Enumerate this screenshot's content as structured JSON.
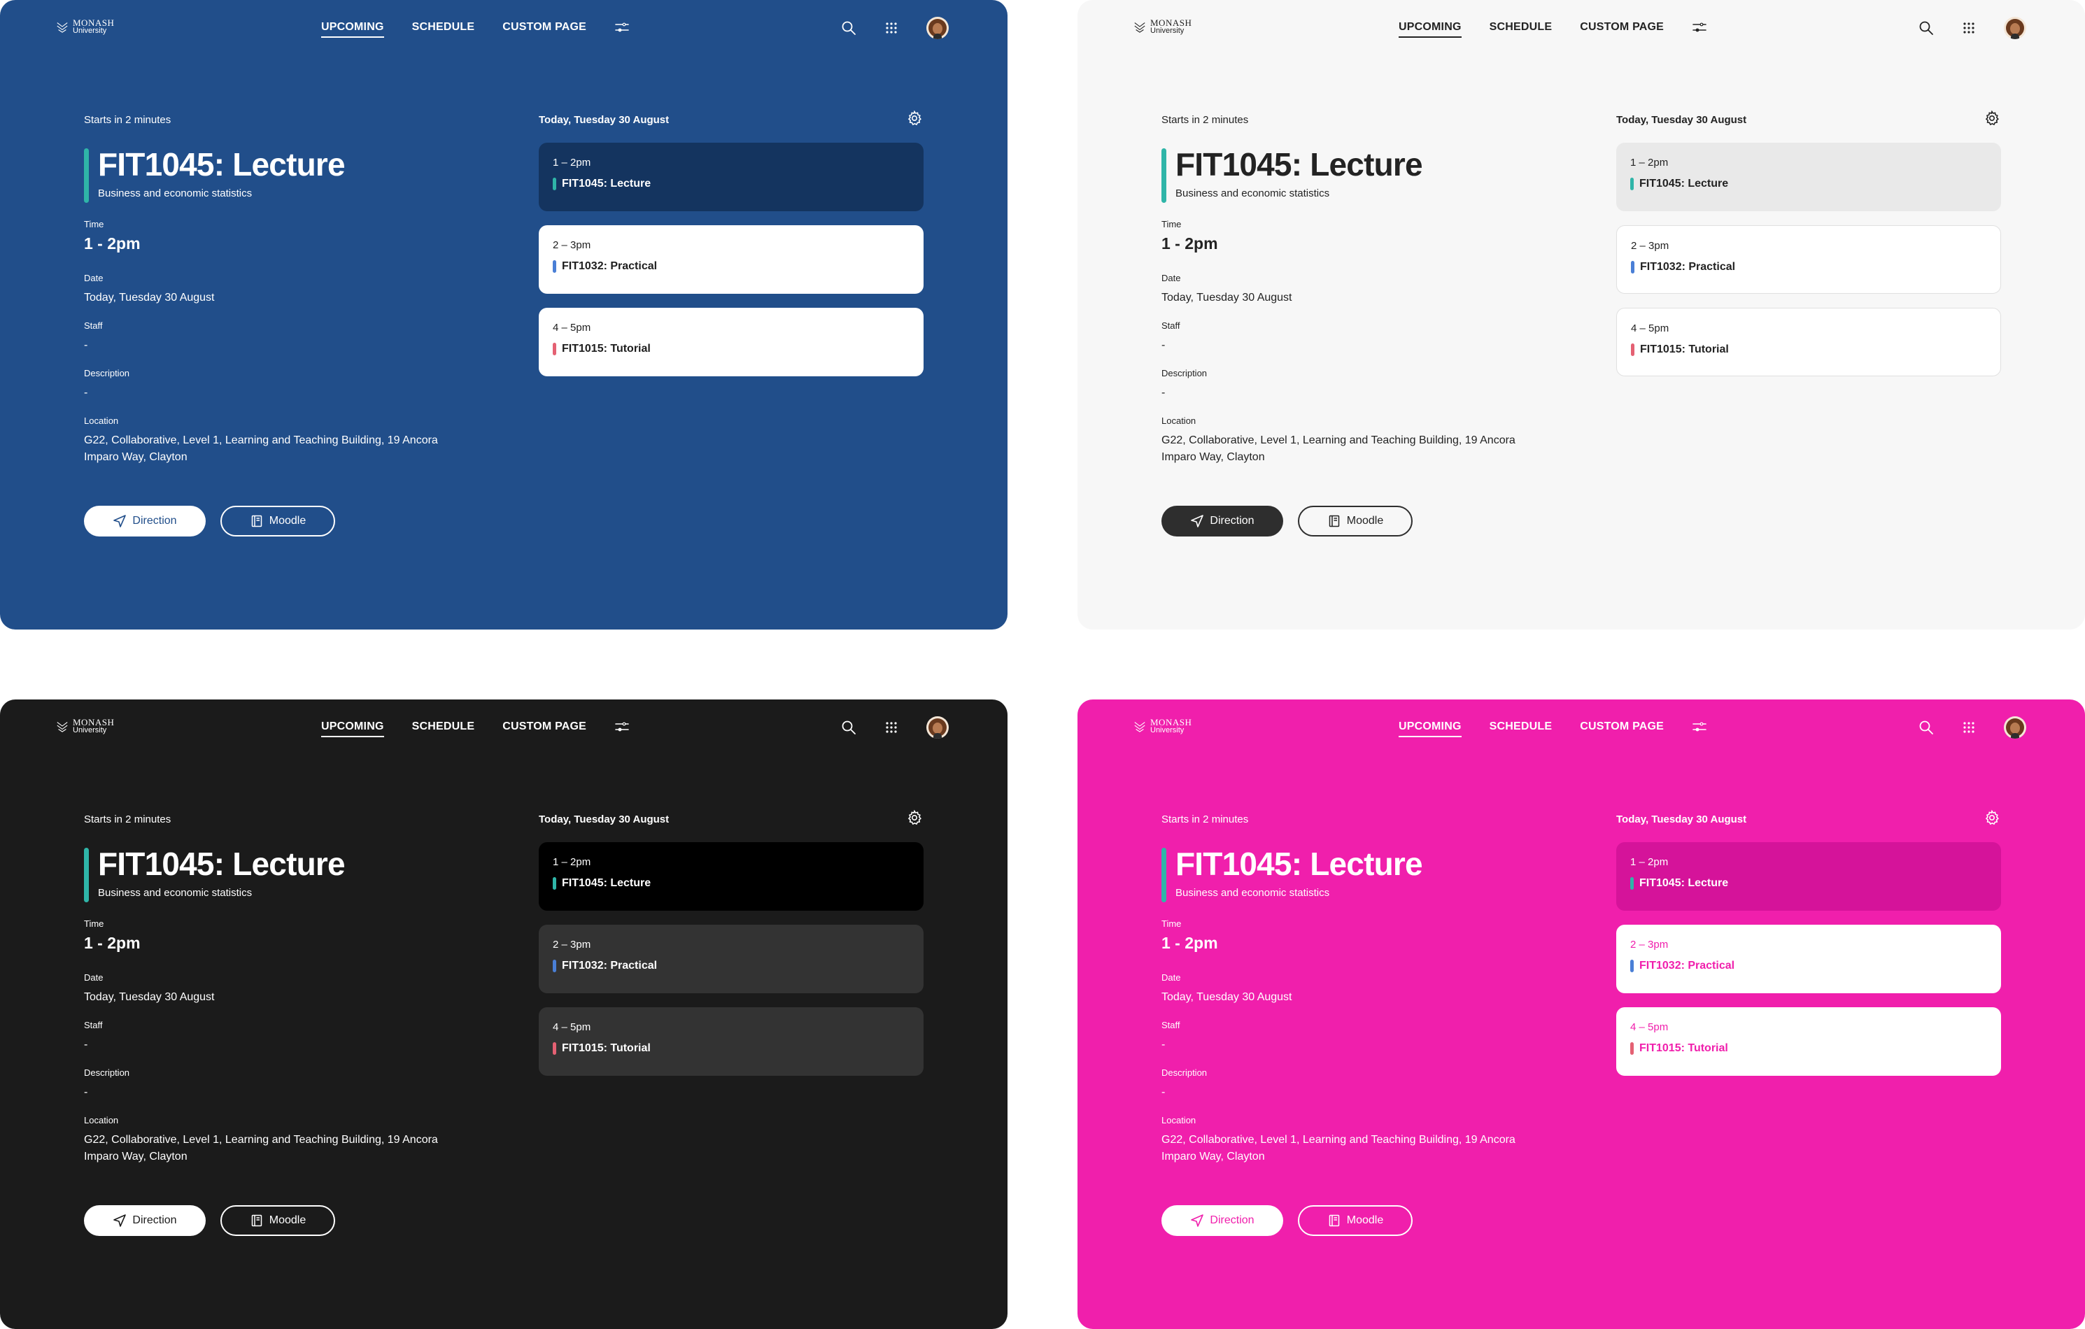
{
  "app": {
    "logo": {
      "name": "MONASH",
      "sub": "University"
    },
    "nav": [
      {
        "label": "UPCOMING"
      },
      {
        "label": "SCHEDULE"
      },
      {
        "label": "CUSTOM PAGE"
      }
    ],
    "icons": [
      "monash-crest-icon",
      "filter-icon",
      "search-icon",
      "apps-grid-icon",
      "settings-icon",
      "direction-icon",
      "book-icon"
    ]
  },
  "themes": [
    {
      "name": "blue",
      "background": "#214e8a"
    },
    {
      "name": "light",
      "background": "#f7f7f7"
    },
    {
      "name": "dark",
      "background": "#1b1b1b"
    },
    {
      "name": "pink",
      "background": "#f01fac"
    }
  ],
  "event": {
    "starts": "Starts in 2 minutes",
    "title": "FIT1045: Lecture",
    "subtitle": "Business and economic statistics",
    "time_label": "Time",
    "time_value": "1 - 2pm",
    "date_label": "Date",
    "date_value": "Today, Tuesday 30 August",
    "staff_label": "Staff",
    "staff_value": "-",
    "desc_label": "Description",
    "desc_value": "-",
    "location_label": "Location",
    "location_value": "G22, Collaborative, Level 1, Learning and Teaching Building, 19 Ancora Imparo Way, Clayton",
    "direction_label": "Direction",
    "moodle_label": "Moodle"
  },
  "schedule": {
    "day": "Today, Tuesday 30 August",
    "items": [
      {
        "time": "1 – 2pm",
        "name": "FIT1045: Lecture",
        "color": "#2fb5a8"
      },
      {
        "time": "2 – 3pm",
        "name": "FIT1032: Practical",
        "color": "#4a7fd6"
      },
      {
        "time": "4 – 5pm",
        "name": "FIT1015: Tutorial",
        "color": "#e46173"
      }
    ]
  }
}
